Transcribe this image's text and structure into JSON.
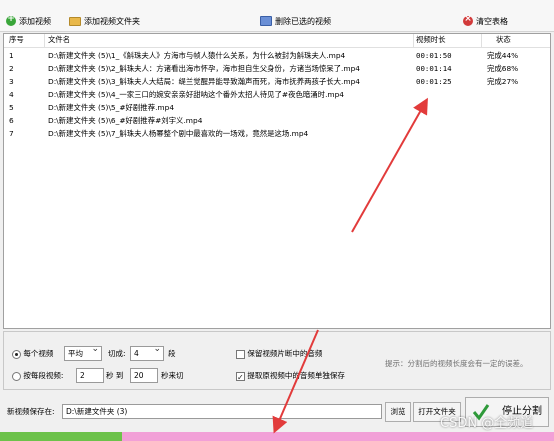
{
  "toolbar": {
    "add_video": "添加视频",
    "add_folder": "添加视频文件夹",
    "delete_selected": "删除已选的视频",
    "clear_table": "清空表格"
  },
  "table": {
    "headers": {
      "index": "序号",
      "filename": "文件名",
      "duration": "视频时长",
      "status": "状态"
    },
    "rows": [
      {
        "index": "1",
        "filename": "D:\\新建文件夹 (5)\\1_《斛珠夫人》方海市与帧人猿什么关系，为什么被封为斛珠夫人.mp4",
        "duration": "00:01:50",
        "status": "完成44%"
      },
      {
        "index": "2",
        "filename": "D:\\新建文件夹 (5)\\2_斛珠夫人：方诸看出海市怀孕，海市担自生父身份，方诸当场惊呆了.mp4",
        "duration": "00:01:14",
        "status": "完成68%"
      },
      {
        "index": "3",
        "filename": "D:\\新建文件夹 (5)\\3_斛珠夫人大结局：缇兰觉醒异能导致瀚声而死，海市抚养两孩子长大.mp4",
        "duration": "00:01:25",
        "status": "完成27%"
      },
      {
        "index": "4",
        "filename": "D:\\新建文件夹 (5)\\4_一家三口的婉安亲亲好甜呐这个番外太招人待见了#夜色暗涌时.mp4",
        "duration": "",
        "status": ""
      },
      {
        "index": "5",
        "filename": "D:\\新建文件夹 (5)\\5_#好剧推荐.mp4",
        "duration": "",
        "status": ""
      },
      {
        "index": "6",
        "filename": "D:\\新建文件夹 (5)\\6_#好剧推荐#刘宇义.mp4",
        "duration": "",
        "status": ""
      },
      {
        "index": "7",
        "filename": "D:\\新建文件夹 (5)\\7_斛珠夫人杨幂整个剧中最喜欢的一场戏，竟然是这场.mp4",
        "duration": "",
        "status": ""
      }
    ]
  },
  "options": {
    "mode1_label": "每个视频",
    "mode1_select": "平均",
    "cut_label": "切成:",
    "cut_count": "4",
    "segment_unit": "段",
    "mode2_label": "按每段视频:",
    "range_from": "2",
    "seconds_to_label": "秒 到",
    "range_to": "20",
    "seconds_cut_label": "秒来切",
    "keep_audio_label": "保留视频片断中的音频",
    "extract_audio_label": "提取原视频中的音频单独保存",
    "tip": "提示：分割后的视频长度会有一定的误差。"
  },
  "save": {
    "label": "新视频保存在:",
    "path": "D:\\新建文件夹 (3)",
    "browse": "浏览",
    "open_folder": "打开文件夹",
    "stop_split": "停止分割"
  },
  "progress": {
    "fraction": 0.22
  },
  "watermark": "CSDN @全频道",
  "colors": {
    "progress_fill": "#6cc24a",
    "progress_track": "#f2a0d7",
    "arrow": "#e23b3b"
  }
}
